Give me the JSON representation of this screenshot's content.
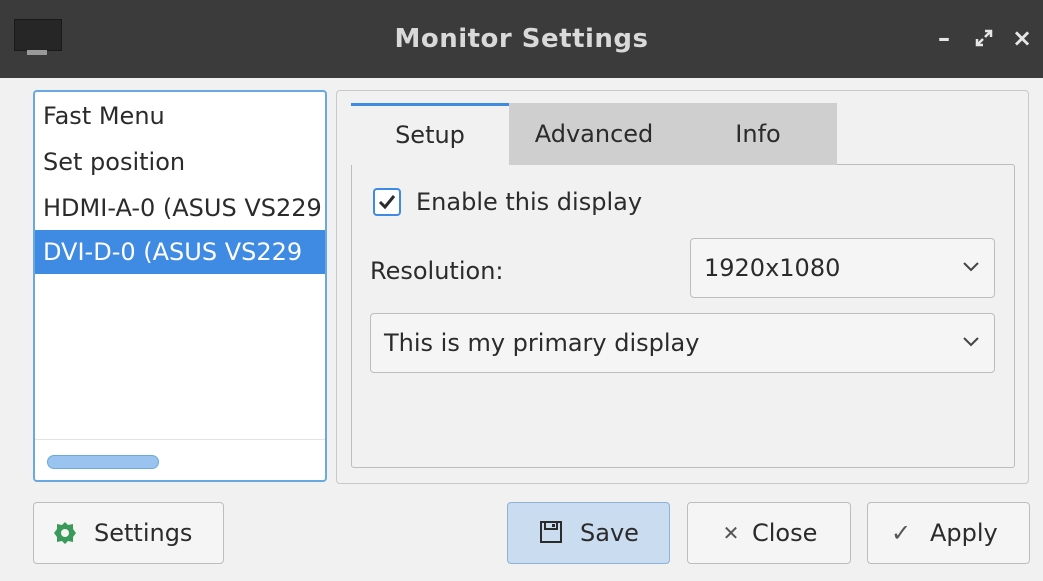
{
  "window": {
    "title": "Monitor Settings",
    "icon": "monitor-icon",
    "controls": {
      "minimize": "–",
      "maximize": "⤢",
      "close": "×"
    }
  },
  "outputs_list": {
    "items": [
      {
        "label": "Fast Menu",
        "selected": false
      },
      {
        "label": "Set position",
        "selected": false
      },
      {
        "label": "HDMI-A-0 (ASUS VS229",
        "selected": false
      },
      {
        "label": "DVI-D-0 (ASUS VS229",
        "selected": true
      }
    ]
  },
  "tabs": [
    {
      "label": "Setup",
      "active": true
    },
    {
      "label": "Advanced",
      "active": false
    },
    {
      "label": "Info",
      "active": false
    }
  ],
  "setup": {
    "enable_label": "Enable this display",
    "enable_checked": true,
    "resolution_label": "Resolution:",
    "resolution_value": "1920x1080",
    "primary_value": "This is my primary display"
  },
  "buttons": {
    "settings": "Settings",
    "save": "Save",
    "close": "Close",
    "apply": "Apply"
  },
  "colors": {
    "accent": "#3f8ae2",
    "titlebar": "#3b3b3b",
    "settings_icon": "#3a9a5a"
  }
}
